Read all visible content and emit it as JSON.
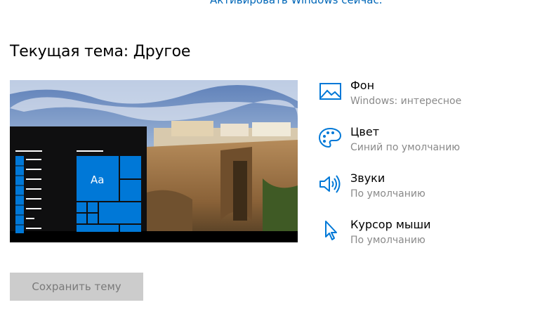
{
  "activation": {
    "link_text": "Активировать Windows сейчас."
  },
  "theme": {
    "title": "Текущая тема: Другое"
  },
  "preview": {
    "tile_label": "Aa"
  },
  "properties": [
    {
      "name": "Фон",
      "value": "Windows: интересное",
      "icon": "picture-icon"
    },
    {
      "name": "Цвет",
      "value": "Синий по умолчанию",
      "icon": "palette-icon"
    },
    {
      "name": "Звуки",
      "value": "По умолчанию",
      "icon": "speaker-icon"
    },
    {
      "name": "Курсор мыши",
      "value": "По умолчанию",
      "icon": "cursor-icon"
    }
  ],
  "actions": {
    "save_label": "Сохранить тему"
  },
  "colors": {
    "accent": "#0078d7",
    "link": "#0067b8",
    "muted_text": "#8a8a8a",
    "button_bg": "#cccccc"
  }
}
